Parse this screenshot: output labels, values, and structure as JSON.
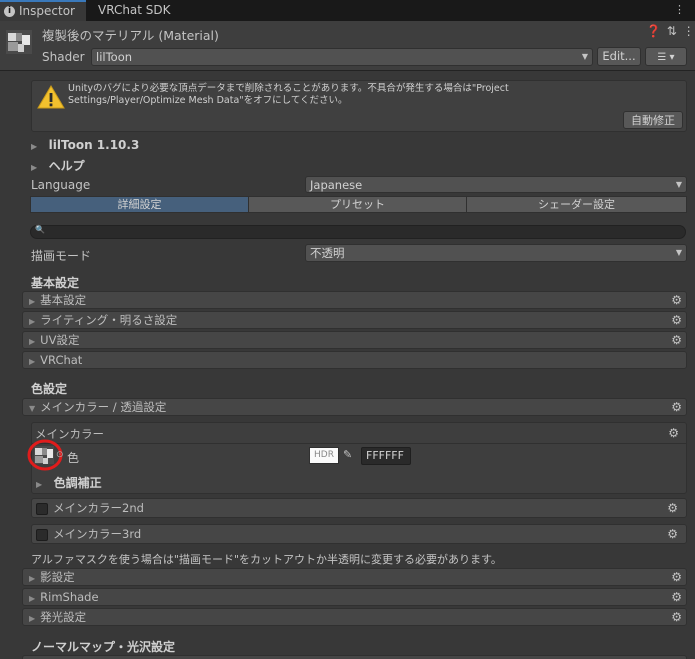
{
  "tabs": {
    "inspector": "Inspector",
    "sdk": "VRChat SDK"
  },
  "header": {
    "title": "複製後のマテリアル (Material)",
    "shader_label": "Shader",
    "shader_value": "lilToon",
    "edit_button": "Edit...",
    "menu_icon": "list-icon"
  },
  "warning": {
    "text": "Unityのバグにより必要な頂点データまで削除されることがあります。不具合が発生する場合は\"Project Settings/Player/Optimize Mesh Data\"をオフにしてください。",
    "fix_button": "自動修正"
  },
  "version": "lilToon 1.10.3",
  "help": "ヘルプ",
  "language": {
    "label": "Language",
    "value": "Japanese"
  },
  "toolbar_tabs": [
    "詳細設定",
    "プリセット",
    "シェーダー設定"
  ],
  "render_mode": {
    "label": "描画モード",
    "value": "不透明"
  },
  "basic_section": {
    "title": "基本設定",
    "items": [
      "基本設定",
      "ライティング・明るさ設定",
      "UV設定",
      "VRChat"
    ]
  },
  "color_section": {
    "title": "色設定",
    "main_color_fold": "メインカラー / 透過設定",
    "main_color_head": "メインカラー",
    "color_label": "色",
    "hdr_label": "HDR",
    "hex_value": "FFFFFF",
    "color_correction": "色調補正",
    "main2": "メインカラー2nd",
    "main3": "メインカラー3rd",
    "alpha_note": "アルファマスクを使う場合は\"描画モード\"をカットアウトか半透明に変更する必要があります。"
  },
  "other_section": {
    "items": [
      "影設定",
      "RimShade",
      "発光設定"
    ]
  },
  "normal_section": {
    "title": "ノーマルマップ・光沢設定"
  },
  "colors": {
    "accent": "#3a79bb",
    "active_tab": "#46607c",
    "highlight_circle": "#e01c1c",
    "warning": "#f2c12e"
  }
}
